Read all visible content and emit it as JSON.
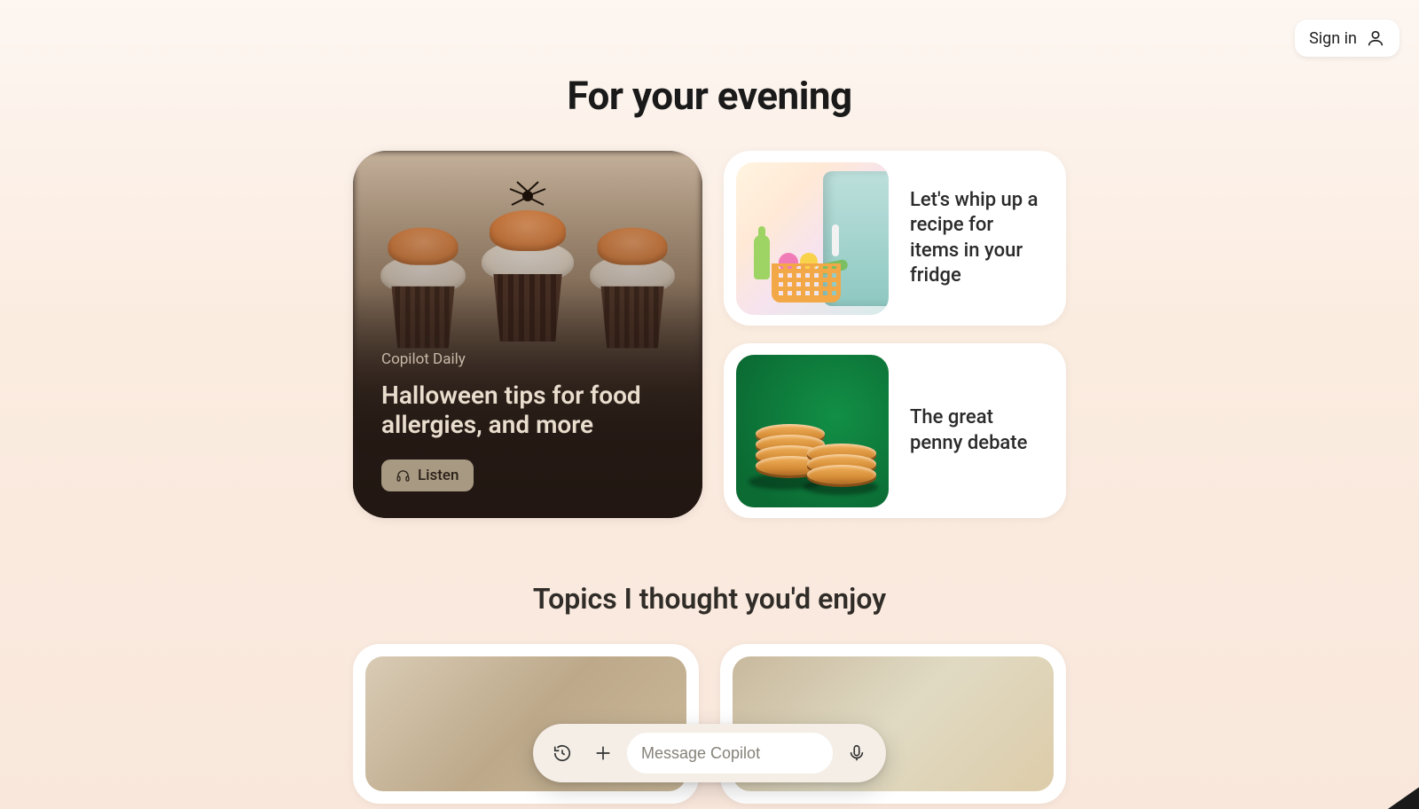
{
  "header": {
    "signin_label": "Sign in"
  },
  "section": {
    "heading": "For your evening",
    "topics_heading": "Topics I thought you'd enjoy"
  },
  "main_card": {
    "eyebrow": "Copilot Daily",
    "title": "Halloween tips for food allergies, and more",
    "listen_label": "Listen"
  },
  "side_cards": [
    {
      "text": "Let's whip up a recipe for items in your fridge"
    },
    {
      "text": "The great penny debate"
    }
  ],
  "composer": {
    "placeholder": "Message Copilot"
  }
}
